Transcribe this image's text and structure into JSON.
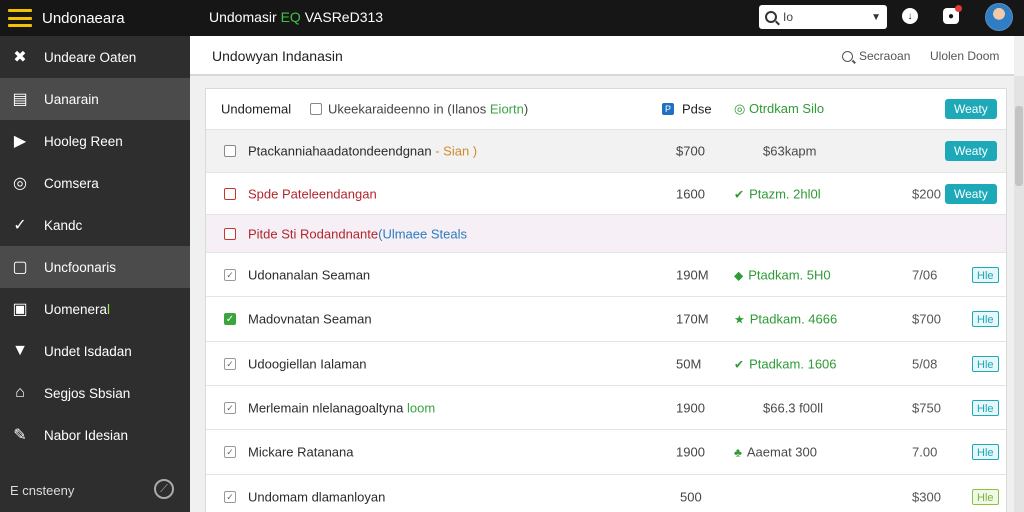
{
  "topbar": {
    "brand": "Undonaeara",
    "title_main": "Undomasir",
    "title_accent": "EQ",
    "title_tail": "VASReD313",
    "search_value": "Io"
  },
  "sidebar": {
    "items": [
      {
        "label": "Undeare Oaten",
        "icon": "tools-icon"
      },
      {
        "label": "Uanarain",
        "icon": "layout-icon"
      },
      {
        "label": "Hooleg Reen",
        "icon": "play-icon"
      },
      {
        "label": "Comsera",
        "icon": "circle-icon"
      },
      {
        "label": "Kandc",
        "icon": "check-circle-icon"
      },
      {
        "label": "Uncfoonaris",
        "icon": "square-icon"
      },
      {
        "label": "Uomenera",
        "label_accent": "l",
        "icon": "printer-icon"
      },
      {
        "label": "Undet Isdadan",
        "icon": "funnel-icon"
      },
      {
        "label": "Segjos Sbsian",
        "icon": "home-icon"
      },
      {
        "label": "Nabor Idesian",
        "icon": "pin-icon"
      }
    ],
    "footer": "E cnsteeny"
  },
  "page": {
    "title": "Undowyan Indanasin",
    "search_label": "Secraoan",
    "open_label": "Ulolen Doom"
  },
  "table": {
    "header": {
      "col1": "Undomemal",
      "col2": "Ukeekaraideenno in (Ilanos ",
      "col2_accent": "Eiortn",
      "col2_tail": ")",
      "col3": "Pdse",
      "col4": "Otrdkam Silo",
      "action": "Weaty"
    },
    "rows": [
      {
        "name": "Ptackanniahaadatondeendgnan",
        "name_accent": " - Sian )",
        "price": "$700",
        "status": "$63kapm",
        "action": "Weaty"
      },
      {
        "name": "Spde Pateleendangan",
        "qty": "1600",
        "status": "Ptazm. 2hl0l",
        "price": "$200",
        "action": "Weaty"
      },
      {
        "name": "Pitde Sti Rodandnante",
        "name_accent": "(Ulmaee Steals"
      },
      {
        "name": "Udonanalan Seaman",
        "qty": "190M",
        "status": "Ptadkam. 5H0",
        "price": "7/06",
        "tag": "Hle"
      },
      {
        "name": "Madovnatan Seaman",
        "qty": "170M",
        "status": "Ptadkam. 4666",
        "price": "$700",
        "tag": "Hle"
      },
      {
        "name": "Udoogiellan Ialaman",
        "qty": "50M",
        "status": "Ptadkam. 1606",
        "price": "5/08",
        "tag": "Hle"
      },
      {
        "name": "Merlemain nlelanagoaltyna",
        "name_accent": " loom",
        "qty": "1900",
        "status": "$66.3 f00ll",
        "price": "$750",
        "tag": "Hle"
      },
      {
        "name": "Mickare Ratanana",
        "qty": "1900",
        "status": "Aaemat 300",
        "price": "7.00",
        "tag": "Hle"
      },
      {
        "name": "Undomam dlamanloyan",
        "qty": "500",
        "price": "$300",
        "tag": "Hle"
      }
    ]
  }
}
